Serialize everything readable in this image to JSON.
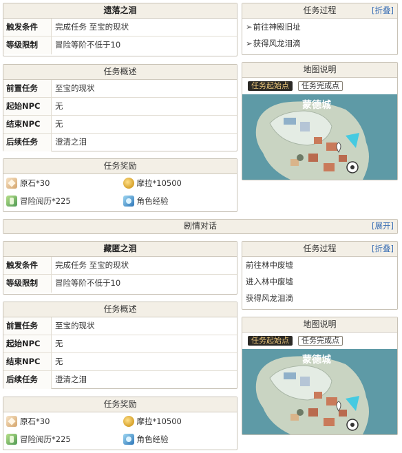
{
  "quest1": {
    "title": "遗落之泪",
    "trigger_label": "触发条件",
    "trigger_value": "完成任务 至宝的现状",
    "level_label": "等级限制",
    "level_value": "冒险等阶不低于10",
    "overview_title": "任务概述",
    "prev_label": "前置任务",
    "prev_value": "至宝的现状",
    "start_label": "起始NPC",
    "start_value": "无",
    "end_label": "结束NPC",
    "end_value": "无",
    "next_label": "后续任务",
    "next_value": "澄清之泪",
    "rewards_title": "任务奖励",
    "rewards": [
      {
        "icon": "primogem-icon",
        "text": "原石*30"
      },
      {
        "icon": "mora-icon",
        "text": "摩拉*10500"
      },
      {
        "icon": "adventure-exp-icon",
        "text": "冒险阅历*225"
      },
      {
        "icon": "character-exp-icon",
        "text": "角色经验"
      }
    ],
    "process_title": "任务过程",
    "process_toggle": "[折叠]",
    "steps": [
      "前往神殿旧址",
      "获得风龙泪滴"
    ],
    "step_marker": "➢",
    "map_title": "地图说明",
    "legend_start": "任务起始点",
    "legend_end": "任务完成点",
    "map_city": "蒙德城"
  },
  "dialogue_bar": {
    "title": "剧情对话",
    "toggle": "[展开]"
  },
  "quest2": {
    "title": "藏匿之泪",
    "trigger_label": "触发条件",
    "trigger_value": "完成任务 至宝的现状",
    "level_label": "等级限制",
    "level_value": "冒险等阶不低于10",
    "overview_title": "任务概述",
    "prev_label": "前置任务",
    "prev_value": "至宝的现状",
    "start_label": "起始NPC",
    "start_value": "无",
    "end_label": "结束NPC",
    "end_value": "无",
    "next_label": "后续任务",
    "next_value": "澄清之泪",
    "rewards_title": "任务奖励",
    "rewards": [
      {
        "icon": "primogem-icon",
        "text": "原石*30"
      },
      {
        "icon": "mora-icon",
        "text": "摩拉*10500"
      },
      {
        "icon": "adventure-exp-icon",
        "text": "冒险阅历*225"
      },
      {
        "icon": "character-exp-icon",
        "text": "角色经验"
      }
    ],
    "process_title": "任务过程",
    "process_toggle": "[折叠]",
    "steps": [
      "前往林中废墟",
      "进入林中废墟",
      "获得风龙泪滴"
    ],
    "map_title": "地图说明",
    "legend_start": "任务起始点",
    "legend_end": "任务完成点",
    "map_city": "蒙德城"
  },
  "colors": {
    "header_bg": "#f3efe6",
    "border": "#c8c2b6",
    "link": "#3a6fb5",
    "legend_start_bg": "#2b2925",
    "legend_start_text": "#e8c47a",
    "map_water": "#5e9aa6"
  }
}
